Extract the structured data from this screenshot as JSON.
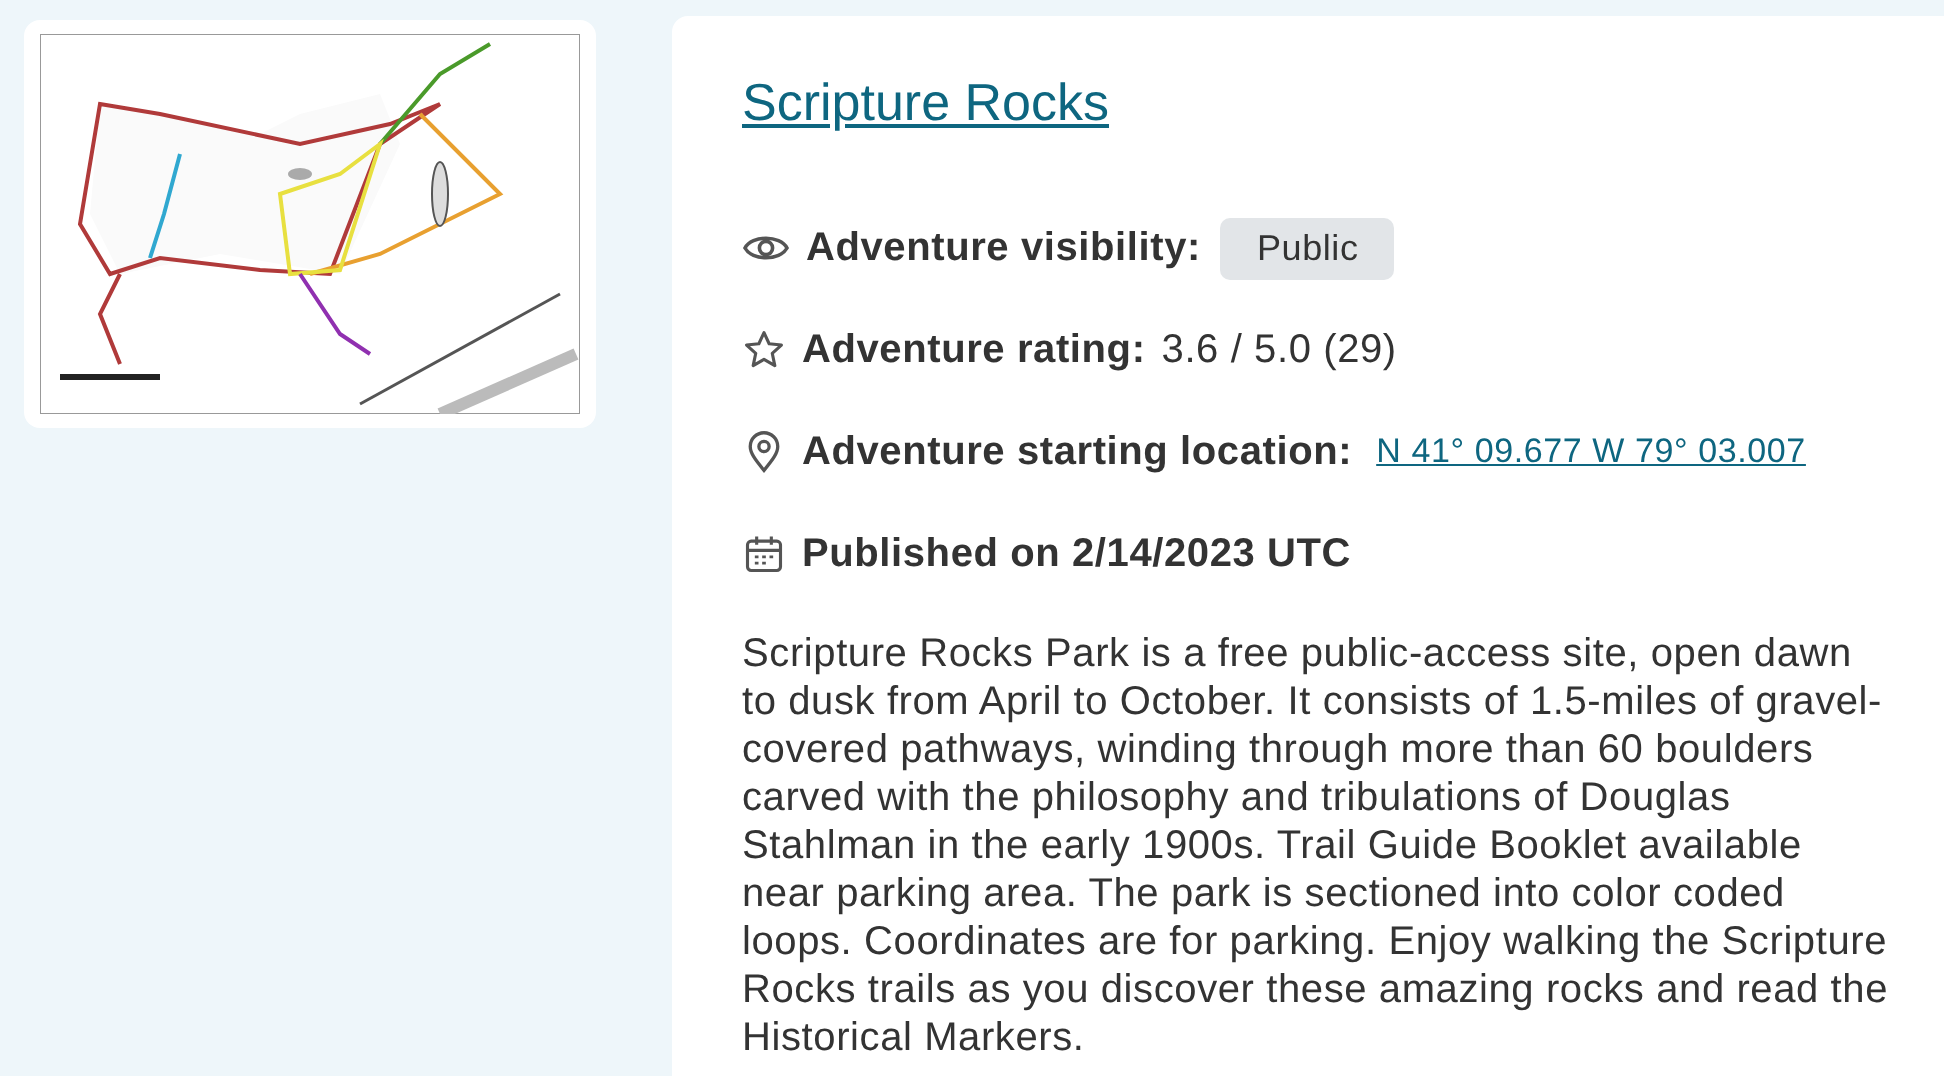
{
  "title": "Scripture Rocks",
  "details": [
    {
      "kind": "visibility",
      "label": "Adventure visibility:",
      "value": "Public"
    },
    {
      "kind": "rating",
      "label": "Adventure rating:",
      "value": "3.6 / 5.0 (29)"
    },
    {
      "kind": "location",
      "label": "Adventure starting location:",
      "value": "N 41° 09.677 W 79° 03.007"
    },
    {
      "kind": "published",
      "label": "Published on 2/14/2023 UTC"
    }
  ],
  "description": "Scripture Rocks Park is a free public-access site, open dawn to dusk from April to October. It consists of 1.5-miles of gravel-covered pathways, winding through more than 60 boulders carved with the philosophy and tribulations of Douglas Stahlman in the early 1900s. Trail Guide Booklet available near parking area. The park is sectioned into color coded loops. Coordinates are for parking. Enjoy walking the Scripture Rocks trails as you discover these amazing rocks and read the Historical Markers."
}
